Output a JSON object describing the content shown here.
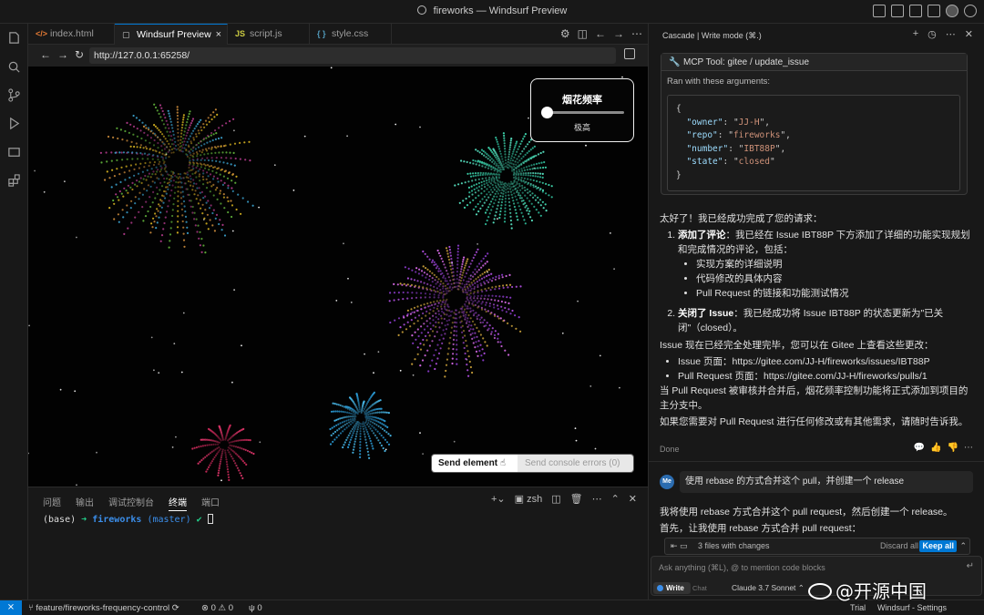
{
  "window": {
    "title": "fireworks — Windsurf Preview"
  },
  "tabs": [
    {
      "label": "index.html",
      "icon": "html-icon"
    },
    {
      "label": "Windsurf Preview",
      "icon": "preview-icon",
      "close": "×"
    },
    {
      "label": "script.js",
      "icon": "JS"
    },
    {
      "label": "style.css",
      "icon": "{ }"
    }
  ],
  "browser": {
    "url": "http://127.0.0.1:65258/"
  },
  "preview": {
    "freq_label": "烟花频率",
    "freq_value_label": "极高",
    "freq_value": 0,
    "send_element": "Send element",
    "send_console": "Send console errors (0)"
  },
  "panel": {
    "tabs": [
      "问题",
      "输出",
      "调试控制台",
      "终端",
      "端口"
    ],
    "active_tab": "终端",
    "shell": "zsh",
    "terminal": {
      "env": "(base)",
      "arrow": "➜",
      "dir": "fireworks",
      "branch": "(master)",
      "ok": "✔"
    }
  },
  "statusbar": {
    "branch": "feature/fireworks-frequency-control",
    "errors": "0",
    "warnings": "0",
    "ports": "0",
    "trial": "Trial",
    "settings": "Windsurf - Settings"
  },
  "cascade": {
    "header": "Cascade | Write mode (⌘.)",
    "mcp_title": "MCP Tool: gitee / update_issue",
    "ran_with": "Ran with these arguments:",
    "args": {
      "owner": "JJ-H",
      "repo": "fireworks",
      "number": "IBT88P",
      "state": "closed"
    },
    "intro": "太好了！我已经成功完成了您的请求：",
    "item1_title": "添加了评论",
    "item1_text": "：我已经在 Issue IBT88P 下方添加了详细的功能实现规划和完成情况的评论，包括：",
    "item1_bullets": [
      "实现方案的详细说明",
      "代码修改的具体内容",
      "Pull Request 的链接和功能测试情况"
    ],
    "item2_title": "关闭了 Issue",
    "item2_text": "：我已经成功将 Issue IBT88P 的状态更新为\"已关闭\"（closed）。",
    "processed": "Issue 现在已经完全处理完毕，您可以在 Gitee 上查看这些更改：",
    "links": [
      "Issue 页面：https://gitee.com/JJ-H/fireworks/issues/IBT88P",
      "Pull Request 页面：https://gitee.com/JJ-H/fireworks/pulls/1"
    ],
    "merge_note": "当 Pull Request 被审核并合并后，烟花频率控制功能将正式添加到项目的主分支中。",
    "closing": "如果您需要对 Pull Request 进行任何修改或有其他需求，请随时告诉我。",
    "done": "Done",
    "me_avatar": "Me",
    "user_msg": "使用 rebase 的方式合并这个 pull，并创建一个 release",
    "reply1": "我将使用 rebase 方式合并这个 pull request，然后创建一个 release。",
    "reply2": "首先，让我使用 rebase 方式合并 pull request：",
    "changes": "3 files with changes",
    "discard": "Discard all",
    "keep": "Keep all",
    "placeholder": "Ask anything (⌘L), @ to mention code blocks",
    "mode_write": "Write",
    "mode_chat": "Chat",
    "model": "Claude 3.7 Sonnet"
  },
  "watermark": "开源中国",
  "colors": {
    "accent": "#0078d4",
    "background": "#1f1f1f",
    "panel": "#181818"
  }
}
